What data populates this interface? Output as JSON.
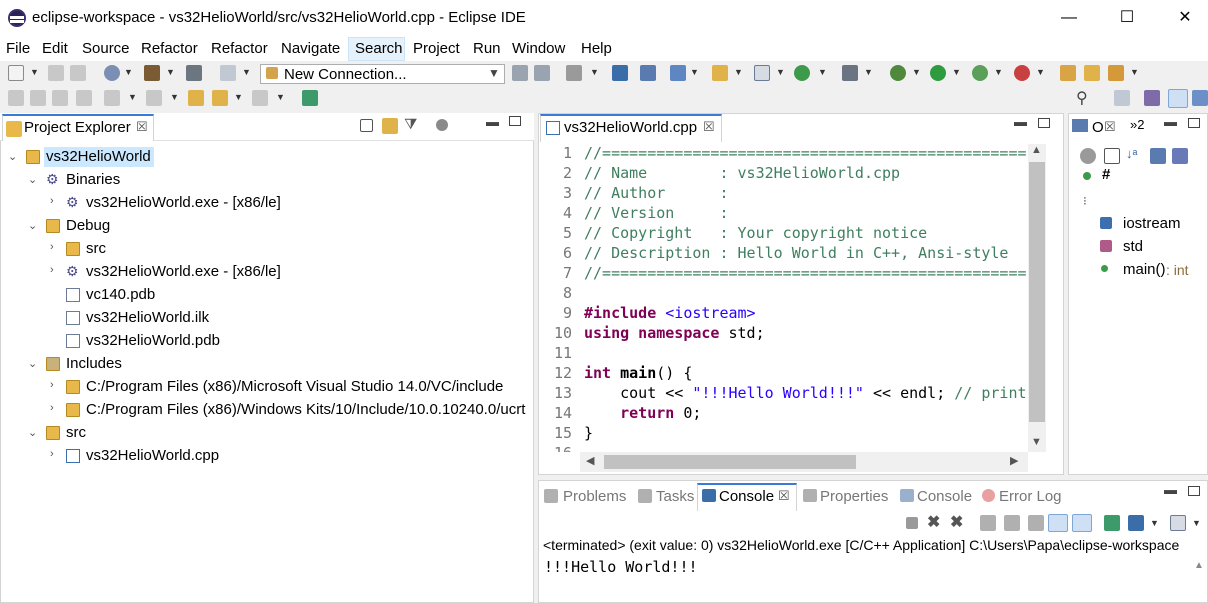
{
  "window": {
    "title": "eclipse-workspace - vs32HelioWorld/src/vs32HelioWorld.cpp - Eclipse IDE",
    "minimize": "—",
    "maximize": "☐",
    "close": "✕"
  },
  "menu": [
    "File",
    "Edit",
    "Source",
    "Refactor",
    "Refactor",
    "Navigate",
    "Search",
    "Project",
    "Run",
    "Window",
    "Help"
  ],
  "toolbar": {
    "connection_combo": "New Connection..."
  },
  "project_explorer": {
    "tab_label": "Project Explorer",
    "tab_close": "☒",
    "tree": [
      {
        "label": "vs32HelioWorld",
        "level": 0,
        "expanded": true,
        "icon": "project-icon"
      },
      {
        "label": "Binaries",
        "level": 1,
        "expanded": true,
        "icon": "binaries-icon"
      },
      {
        "label": "vs32HelioWorld.exe - [x86/le]",
        "level": 2,
        "expanded": false,
        "icon": "exe-icon"
      },
      {
        "label": "Debug",
        "level": 1,
        "expanded": true,
        "icon": "folder-icon"
      },
      {
        "label": "src",
        "level": 2,
        "expanded": false,
        "icon": "folder-icon"
      },
      {
        "label": "vs32HelioWorld.exe - [x86/le]",
        "level": 2,
        "expanded": false,
        "icon": "exe-icon"
      },
      {
        "label": "vc140.pdb",
        "level": 2,
        "expanded": null,
        "icon": "file-icon"
      },
      {
        "label": "vs32HelioWorld.ilk",
        "level": 2,
        "expanded": null,
        "icon": "file-icon"
      },
      {
        "label": "vs32HelioWorld.pdb",
        "level": 2,
        "expanded": null,
        "icon": "file-icon"
      },
      {
        "label": "Includes",
        "level": 1,
        "expanded": true,
        "icon": "includes-icon"
      },
      {
        "label": "C:/Program Files (x86)/Microsoft Visual Studio 14.0/VC/include",
        "level": 2,
        "expanded": false,
        "icon": "include-folder-icon"
      },
      {
        "label": "C:/Program Files (x86)/Windows Kits/10/Include/10.0.10240.0/ucrt",
        "level": 2,
        "expanded": false,
        "icon": "include-folder-icon"
      },
      {
        "label": "src",
        "level": 1,
        "expanded": true,
        "icon": "source-folder-icon"
      },
      {
        "label": "vs32HelioWorld.cpp",
        "level": 2,
        "expanded": false,
        "icon": "cpp-file-icon"
      }
    ]
  },
  "editor": {
    "tab_label": "vs32HelioWorld.cpp",
    "tab_close": "☒",
    "lines": [
      {
        "n": "1",
        "html": "<span class=\"cm\">//============================================================</span>"
      },
      {
        "n": "2",
        "html": "<span class=\"cm\">// Name        : vs32HelioWorld.cpp</span>"
      },
      {
        "n": "3",
        "html": "<span class=\"cm\">// Author      :</span>"
      },
      {
        "n": "4",
        "html": "<span class=\"cm\">// Version     :</span>"
      },
      {
        "n": "5",
        "html": "<span class=\"cm\">// Copyright   : Your copyright notice</span>"
      },
      {
        "n": "6",
        "html": "<span class=\"cm\">// Description : Hello World in C++, Ansi-style</span>"
      },
      {
        "n": "7",
        "html": "<span class=\"cm\">//============================================================</span>"
      },
      {
        "n": "8",
        "html": ""
      },
      {
        "n": "9",
        "html": "<span class=\"kw\">#include</span> <span class=\"inc\">&lt;iostream&gt;</span>"
      },
      {
        "n": "10",
        "html": "<span class=\"kw\">using namespace</span> std;"
      },
      {
        "n": "11",
        "html": ""
      },
      {
        "n": "12",
        "html": "<span class=\"kw\">int</span> <b>main</b>() {"
      },
      {
        "n": "13",
        "html": "    cout &lt;&lt; <span class=\"str\">\"!!!Hello World!!!\"</span> &lt;&lt; endl; <span class=\"cm\">// prints !!!Hello World!!!</span>"
      },
      {
        "n": "14",
        "html": "    <span class=\"kw\">return</span> 0;"
      },
      {
        "n": "15",
        "html": "}"
      },
      {
        "n": "16",
        "html": ""
      }
    ]
  },
  "outline": {
    "tab_label": "O",
    "tab_close": "☒",
    "tab2_label": "»2",
    "items": [
      {
        "label": "iostream",
        "icon": "include-icon"
      },
      {
        "label": "std",
        "icon": "namespace-icon"
      },
      {
        "label": "main()",
        "suffix": " : int",
        "icon": "function-icon"
      }
    ]
  },
  "bottom": {
    "tabs": [
      {
        "label": "Problems",
        "active": false
      },
      {
        "label": "Tasks",
        "active": false
      },
      {
        "label": "Console",
        "active": true
      },
      {
        "label": "Properties",
        "active": false
      },
      {
        "label": "Console",
        "active": false
      },
      {
        "label": "Error Log",
        "active": false
      }
    ],
    "status": "<terminated> (exit value: 0) vs32HelioWorld.exe [C/C++ Application] C:\\Users\\Papa\\eclipse-workspace",
    "output": "!!!Hello World!!!"
  },
  "colors": {
    "accent": "#3a7bd5",
    "comment": "#3f7f5f",
    "keyword": "#7f0055",
    "string": "#2a00ff"
  }
}
